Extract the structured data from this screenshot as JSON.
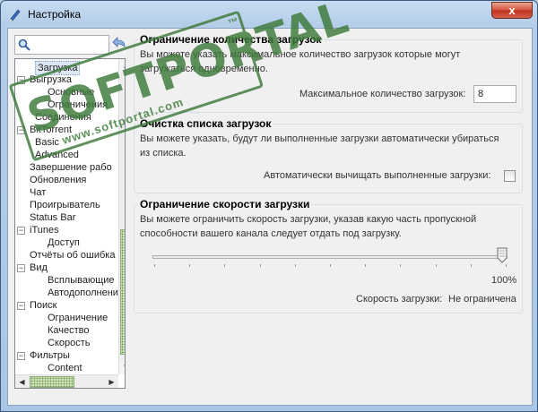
{
  "window": {
    "title": "Настройка",
    "close_glyph": "x",
    "icon": "pen-icon"
  },
  "search": {
    "placeholder": "",
    "value": ""
  },
  "tree": {
    "items": [
      {
        "label": "Загрузка",
        "level": 1,
        "selected": true,
        "exp": ""
      },
      {
        "label": "Выгрузка",
        "level": 0,
        "exp": "−"
      },
      {
        "label": "Основные",
        "level": 2,
        "exp": ""
      },
      {
        "label": "Ограничения",
        "level": 2,
        "exp": ""
      },
      {
        "label": "Соединения",
        "level": 1,
        "exp": ""
      },
      {
        "label": "BitTorrent",
        "level": 0,
        "exp": "−"
      },
      {
        "label": "Basic",
        "level": 1,
        "exp": ""
      },
      {
        "label": "Advanced",
        "level": 1,
        "exp": ""
      },
      {
        "label": "Завершение рабо",
        "level": 0,
        "exp": ""
      },
      {
        "label": "Обновления",
        "level": 0,
        "exp": ""
      },
      {
        "label": "Чат",
        "level": 0,
        "exp": ""
      },
      {
        "label": "Проигрыватель",
        "level": 0,
        "exp": ""
      },
      {
        "label": "Status Bar",
        "level": 0,
        "exp": ""
      },
      {
        "label": "iTunes",
        "level": 0,
        "exp": "−"
      },
      {
        "label": "Доступ",
        "level": 2,
        "exp": ""
      },
      {
        "label": "Отчёты об ошибка",
        "level": 0,
        "exp": ""
      },
      {
        "label": "Вид",
        "level": 0,
        "exp": "−"
      },
      {
        "label": "Всплывающие",
        "level": 2,
        "exp": ""
      },
      {
        "label": "Автодополнени",
        "level": 2,
        "exp": ""
      },
      {
        "label": "Поиск",
        "level": 0,
        "exp": "−"
      },
      {
        "label": "Ограничение",
        "level": 2,
        "exp": ""
      },
      {
        "label": "Качество",
        "level": 2,
        "exp": ""
      },
      {
        "label": "Скорость",
        "level": 2,
        "exp": ""
      },
      {
        "label": "Фильтры",
        "level": 0,
        "exp": "−"
      },
      {
        "label": "Content",
        "level": 2,
        "exp": ""
      }
    ]
  },
  "groups": {
    "limit": {
      "title": "Ограничение количества загрузок",
      "desc_line1": "Вы можете указать максимальное количество загрузок которые могут",
      "desc_line2": "загружаться одновременно.",
      "field_label": "Максимальное количество загрузок:",
      "field_value": "8"
    },
    "cleanup": {
      "title": "Очистка списка загрузок",
      "desc_line1": "Вы можете указать, будут ли выполненные загрузки автоматически убираться",
      "desc_line2": "из списка.",
      "checkbox_label": "Автоматически вычищать выполненные загрузки:",
      "checked": false
    },
    "speed": {
      "title": "Ограничение скорости загрузки",
      "desc_line1": "Вы можете ограничить скорость загрузки, указав какую часть пропускной",
      "desc_line2": "способности вашего канала следует отдать под загрузку.",
      "slider_value_label": "100%",
      "slider_fraction": 1.0,
      "speed_label": "Скорость загрузки:",
      "speed_value": "Не ограничена"
    }
  },
  "watermark": {
    "text": "SOFTPORTAL",
    "tm": "™",
    "url": "www.softportal.com"
  },
  "colors": {
    "accent_green": "#3d7a3a",
    "selection": "#dde7f4"
  }
}
